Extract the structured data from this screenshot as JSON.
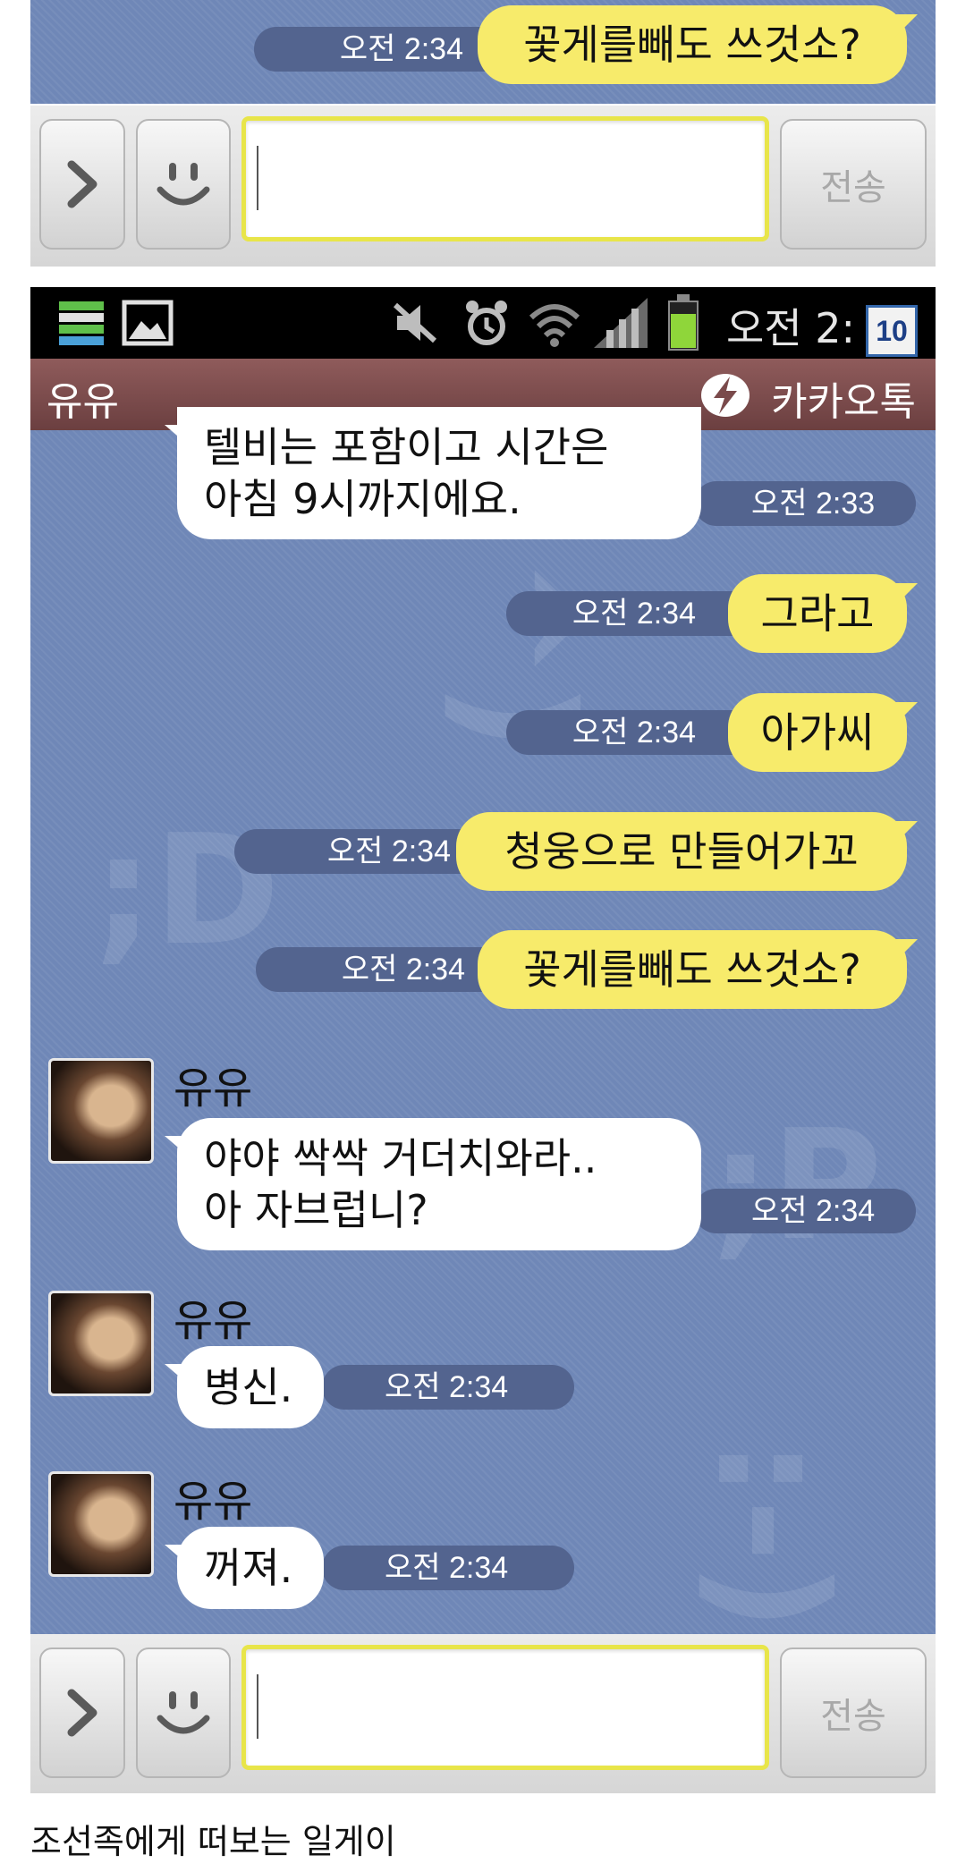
{
  "top_fragment": {
    "messages": [
      {
        "side": "out",
        "time": "오전 2:34",
        "text": "꽃게를빼도 쓰것소?"
      }
    ],
    "send_label": "전송"
  },
  "status_bar": {
    "clock": "오전 2:",
    "page_badge": "10",
    "icons": [
      "list-icon",
      "image-icon",
      "mute-icon",
      "alarm-icon",
      "wifi-icon",
      "signal-icon",
      "battery-icon"
    ]
  },
  "chat_header": {
    "contact_name": "유유",
    "app_name": "카카오톡"
  },
  "messages": [
    {
      "side": "in",
      "text_line1": "텔비는 포함이고 시간은",
      "text_line2": "아침 9시까지에요.",
      "time": "오전 2:33"
    },
    {
      "side": "out",
      "text": "그라고",
      "time": "오전 2:34"
    },
    {
      "side": "out",
      "text": "아가씨",
      "time": "오전 2:34"
    },
    {
      "side": "out",
      "text": "청웅으로 만들어가꼬",
      "time": "오전 2:34"
    },
    {
      "side": "out",
      "text": "꽃게를빼도 쓰것소?",
      "time": "오전 2:34"
    },
    {
      "side": "in",
      "sender": "유유",
      "text_line1": "야야 싹싹 거더치와라..",
      "text_line2": "아 자브럽니?",
      "time": "오전 2:34"
    },
    {
      "side": "in",
      "sender": "유유",
      "text": "병신.",
      "time": "오전 2:34"
    },
    {
      "side": "in",
      "sender": "유유",
      "text": "꺼져.",
      "time": "오전 2:34"
    }
  ],
  "input_panel": {
    "input_value": "",
    "send_label": "전송"
  },
  "background_emoticons": [
    ";^)",
    ";D",
    ";P",
    ":-)"
  ],
  "caption": "조선족에게 떠보는 일게이",
  "colors": {
    "chat_background": "#6f87b7",
    "outgoing_bubble": "#f7eb6b",
    "incoming_bubble": "#ffffff",
    "timestamp_pill": "#53648f",
    "title_bar": "#7a4a4b"
  }
}
